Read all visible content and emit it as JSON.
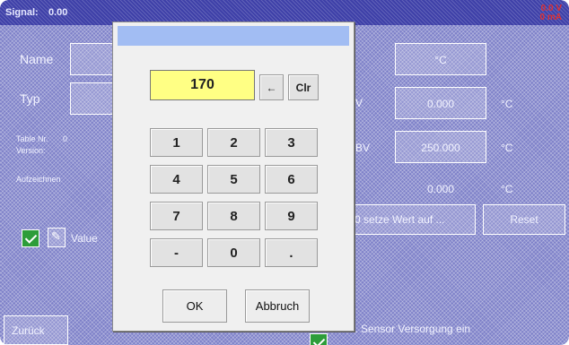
{
  "status": {
    "signal_label": "Signal:",
    "signal_value": "0.00",
    "alarm_top": "0.0 V",
    "alarm_bottom": "0 mA"
  },
  "form": {
    "name_label": "Name",
    "type_label": "Typ",
    "table_no_label": "Table Nr.",
    "table_no_value": "0",
    "version_label": "Version:",
    "record_label": "Aufzeichnen",
    "value_label": "Value",
    "unit_value": "°C",
    "fourma_suffix": "V",
    "twentyma_suffix": "BV",
    "fourma_value": "0.000",
    "fourma_unit": "°C",
    "twentyma_value": "250.000",
    "twentyma_unit": "°C",
    "offset_value": "0.000",
    "offset_unit": "°C",
    "set_value_button": "0 setze Wert auf ...",
    "reset_button": "Reset",
    "back_button": "Zurück",
    "sensor_supply_label": "t. Sensor Versorgung ein"
  },
  "dialog": {
    "display_value": "170",
    "backspace": "←",
    "clear": "Clr",
    "keys": [
      "1",
      "2",
      "3",
      "4",
      "5",
      "6",
      "7",
      "8",
      "9",
      "-",
      "0",
      "."
    ],
    "ok": "OK",
    "cancel": "Abbruch"
  }
}
